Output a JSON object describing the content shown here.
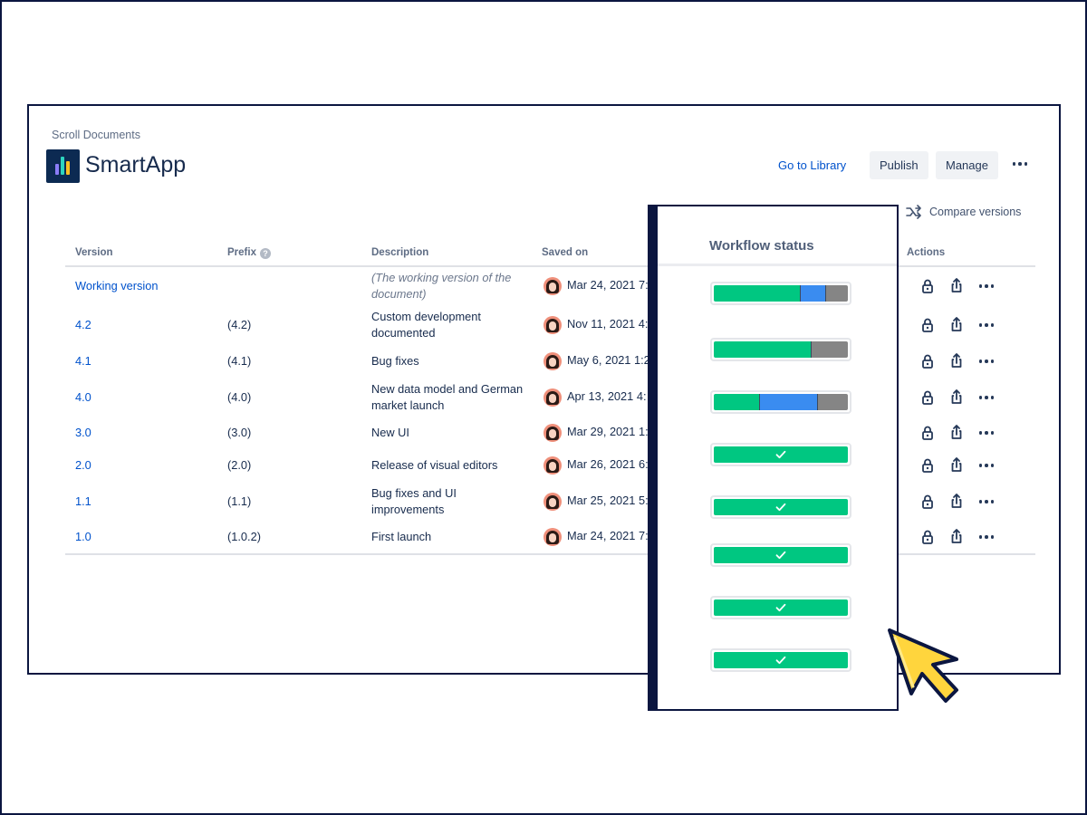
{
  "header": {
    "space_name": "Scroll Documents",
    "app_title": "SmartApp",
    "go_to_library": "Go to Library",
    "publish": "Publish",
    "manage": "Manage",
    "compare_versions": "Compare versions"
  },
  "table": {
    "columns": {
      "version": "Version",
      "prefix": "Prefix",
      "description": "Description",
      "saved_on": "Saved on",
      "actions": "Actions"
    },
    "rows": [
      {
        "version": "Working version",
        "prefix": "",
        "description_1": "(The working version of the",
        "description_2": "document)",
        "saved_on": "Mar 24, 2021 7:"
      },
      {
        "version": "4.2",
        "prefix": "(4.2)",
        "description_1": "Custom development",
        "description_2": "documented",
        "saved_on": "Nov 11, 2021 4:"
      },
      {
        "version": "4.1",
        "prefix": "(4.1)",
        "description_1": "Bug fixes",
        "description_2": "",
        "saved_on": "May 6, 2021 1:2"
      },
      {
        "version": "4.0",
        "prefix": "(4.0)",
        "description_1": "New data model and German",
        "description_2": "market launch",
        "saved_on": "Apr 13, 2021 4:"
      },
      {
        "version": "3.0",
        "prefix": "(3.0)",
        "description_1": "New UI",
        "description_2": "",
        "saved_on": "Mar 29, 2021 1:"
      },
      {
        "version": "2.0",
        "prefix": "(2.0)",
        "description_1": "Release of visual editors",
        "description_2": "",
        "saved_on": "Mar 26, 2021 6:"
      },
      {
        "version": "1.1",
        "prefix": "(1.1)",
        "description_1": "Bug fixes and UI",
        "description_2": "improvements",
        "saved_on": "Mar 25, 2021 5:"
      },
      {
        "version": "1.0",
        "prefix": "(1.0.2)",
        "description_1": "First launch",
        "description_2": "",
        "saved_on": "Mar 24, 2021 7:"
      }
    ]
  },
  "workflow": {
    "title": "Workflow status",
    "bars": [
      {
        "segments": [
          {
            "status": "green",
            "fraction": 0.64
          },
          {
            "status": "blue",
            "fraction": 0.19
          },
          {
            "status": "gray",
            "fraction": 0.17
          }
        ],
        "complete": false
      },
      {
        "segments": [
          {
            "status": "green",
            "fraction": 0.72
          },
          {
            "status": "gray",
            "fraction": 0.28
          }
        ],
        "complete": false
      },
      {
        "segments": [
          {
            "status": "green",
            "fraction": 0.34
          },
          {
            "status": "blue",
            "fraction": 0.43
          },
          {
            "status": "gray",
            "fraction": 0.23
          }
        ],
        "complete": false
      },
      {
        "segments": [
          {
            "status": "green",
            "fraction": 1.0
          }
        ],
        "complete": true
      },
      {
        "segments": [
          {
            "status": "green",
            "fraction": 1.0
          }
        ],
        "complete": true
      },
      {
        "segments": [
          {
            "status": "green",
            "fraction": 1.0
          }
        ],
        "complete": true
      },
      {
        "segments": [
          {
            "status": "green",
            "fraction": 1.0
          }
        ],
        "complete": true
      },
      {
        "segments": [
          {
            "status": "green",
            "fraction": 1.0
          }
        ],
        "complete": true
      }
    ]
  },
  "colors": {
    "frame": "#0b1640",
    "link": "#0052cc",
    "status_green": "#00c781",
    "status_blue": "#3a8cf0",
    "status_gray": "#858585",
    "cursor": "#ffd53d"
  },
  "icons": {
    "actions": [
      "lock-icon",
      "share-icon",
      "more-icon"
    ],
    "compare": "compare-arrows-icon",
    "cursor": "mouse-pointer-icon"
  }
}
